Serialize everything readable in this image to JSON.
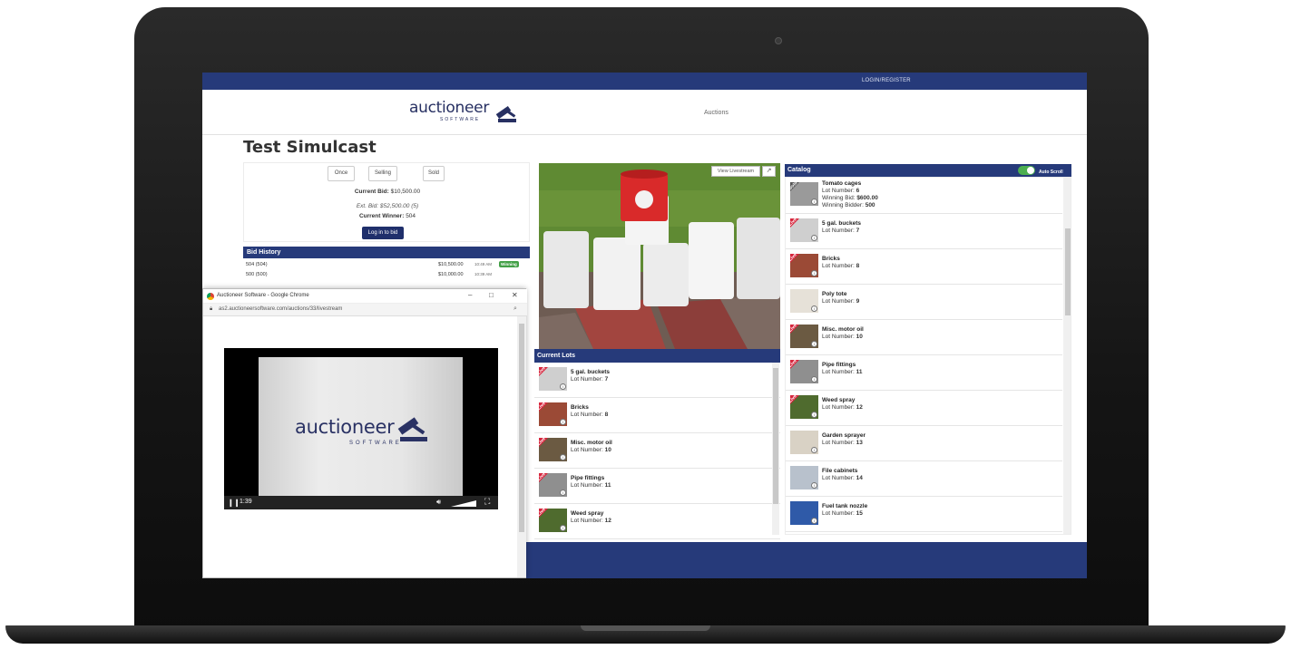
{
  "topbar": {
    "login_register": "LOGIN/REGISTER"
  },
  "navbar": {
    "logo_text": "auctioneer",
    "logo_sub": "SOFTWARE",
    "nav_auctions": "Auctions"
  },
  "page": {
    "title": "Test Simulcast"
  },
  "bid_panel": {
    "buttons": [
      "Once",
      "Selling",
      "Sold"
    ],
    "current_bid_label": "Current Bid:",
    "current_bid_value": "$10,500.00",
    "ext_bid": "Ext. Bid: $52,500.00 (5)",
    "current_winner_label": "Current Winner:",
    "current_winner_value": "504",
    "login_button": "Log in to bid"
  },
  "bid_history": {
    "title": "Bid History",
    "rows": [
      {
        "bidder": "504 (504)",
        "amount": "$10,500.00",
        "time": "10:49 AM",
        "badge": "Winning"
      },
      {
        "bidder": "500 (500)",
        "amount": "$10,000.00",
        "time": "10:39 AM",
        "badge": ""
      }
    ]
  },
  "popup": {
    "title": "Auctioneer Software - Google Chrome",
    "url": "as2.auctioneersoftware.com/auctions/33/livestream",
    "controls": {
      "minimize": "–",
      "maximize": "□",
      "close": "✕"
    },
    "video": {
      "logo_text": "auctioneer",
      "logo_sub": "SOFTWARE",
      "time": "1:39"
    }
  },
  "stream": {
    "view_livestream": "View Livestream"
  },
  "current_lots": {
    "title": "Current Lots",
    "lot_number_label": "Lot Number:",
    "items": [
      {
        "name": "5 gal. buckets",
        "lot_number": "7",
        "ribbon": "Live"
      },
      {
        "name": "Bricks",
        "lot_number": "8",
        "ribbon": "Live"
      },
      {
        "name": "Misc. motor oil",
        "lot_number": "10",
        "ribbon": "Live"
      },
      {
        "name": "Pipe fittings",
        "lot_number": "11",
        "ribbon": "Live"
      },
      {
        "name": "Weed spray",
        "lot_number": "12",
        "ribbon": "Live"
      }
    ]
  },
  "catalog": {
    "title": "Catalog",
    "auto_scroll_label": "Auto Scroll",
    "lot_number_label": "Lot Number:",
    "items": [
      {
        "name": "Tomato cages",
        "lot_number": "6",
        "ribbon": "Sold",
        "winning_bid_label": "Winning Bid:",
        "winning_bid": "$600.00",
        "winning_bidder_label": "Winning Bidder:",
        "winning_bidder": "500"
      },
      {
        "name": "5 gal. buckets",
        "lot_number": "7",
        "ribbon": "Live"
      },
      {
        "name": "Bricks",
        "lot_number": "8",
        "ribbon": "Live"
      },
      {
        "name": "Poly tote",
        "lot_number": "9",
        "ribbon": ""
      },
      {
        "name": "Misc. motor oil",
        "lot_number": "10",
        "ribbon": "Live"
      },
      {
        "name": "Pipe fittings",
        "lot_number": "11",
        "ribbon": "Live"
      },
      {
        "name": "Weed spray",
        "lot_number": "12",
        "ribbon": "Live"
      },
      {
        "name": "Garden sprayer",
        "lot_number": "13",
        "ribbon": ""
      },
      {
        "name": "File cabinets",
        "lot_number": "14",
        "ribbon": ""
      },
      {
        "name": "Fuel tank nozzle",
        "lot_number": "15",
        "ribbon": ""
      }
    ]
  },
  "colors": {
    "navy": "#263a7a",
    "live_ribbon": "#d7263d",
    "sold_ribbon": "#555555",
    "winning": "#43a047"
  }
}
